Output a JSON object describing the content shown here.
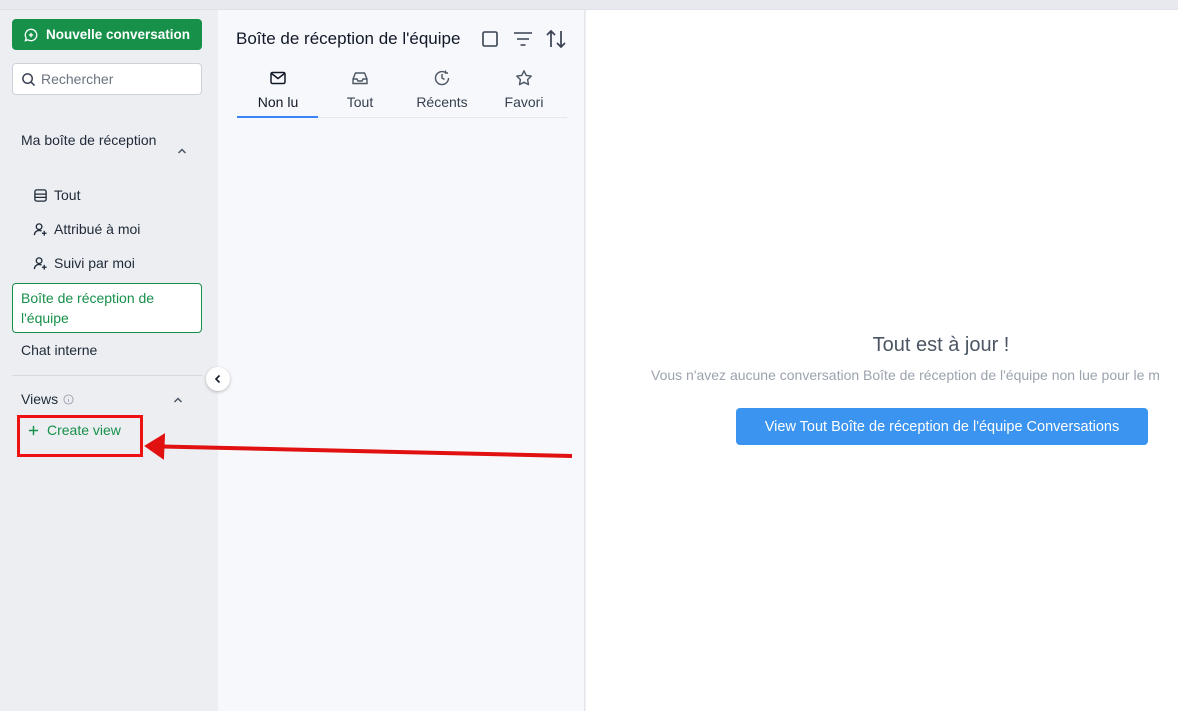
{
  "sidebar": {
    "new_conversation": "Nouvelle conversation",
    "search_placeholder": "Rechercher",
    "my_inbox": "Ma boîte de réception",
    "items": [
      {
        "label": "Tout",
        "icon": "stack-icon"
      },
      {
        "label": "Attribué à moi",
        "icon": "user-plus-icon"
      },
      {
        "label": "Suivi par moi",
        "icon": "user-plus-icon"
      }
    ],
    "team_inbox": "Boîte de réception de l'équipe",
    "internal_chat": "Chat interne",
    "views_label": "Views",
    "create_view": "Create view"
  },
  "list": {
    "title": "Boîte de réception de l'équipe",
    "tabs": [
      {
        "label": "Non lu",
        "icon": "mail-icon",
        "active": true
      },
      {
        "label": "Tout",
        "icon": "inbox-icon",
        "active": false
      },
      {
        "label": "Récents",
        "icon": "clock-icon",
        "active": false
      },
      {
        "label": "Favori",
        "icon": "star-icon",
        "active": false
      }
    ]
  },
  "main": {
    "empty_title": "Tout est à jour !",
    "empty_subtitle": "Vous n'avez aucune conversation Boîte de réception de l'équipe non lue pour le m",
    "view_button": "View Tout Boîte de réception de l'équipe Conversations"
  },
  "colors": {
    "brand_green": "#17904a",
    "primary_blue": "#3b94f0",
    "annotation_red": "#e11111"
  }
}
